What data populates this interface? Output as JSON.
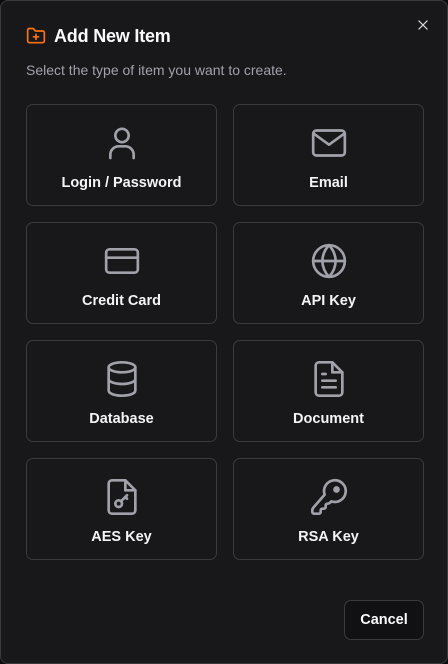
{
  "dialog": {
    "title": "Add New Item",
    "subtitle": "Select the type of item you want to create.",
    "title_icon": "folder-plus-icon",
    "close_icon": "close-icon",
    "accent_color": "#f97316"
  },
  "items": [
    {
      "label": "Login / Password",
      "icon": "user-icon"
    },
    {
      "label": "Email",
      "icon": "mail-icon"
    },
    {
      "label": "Credit Card",
      "icon": "credit-card-icon"
    },
    {
      "label": "API Key",
      "icon": "globe-icon"
    },
    {
      "label": "Database",
      "icon": "database-icon"
    },
    {
      "label": "Document",
      "icon": "document-icon"
    },
    {
      "label": "AES Key",
      "icon": "file-key-icon"
    },
    {
      "label": "RSA Key",
      "icon": "key-icon"
    }
  ],
  "footer": {
    "cancel_label": "Cancel"
  }
}
